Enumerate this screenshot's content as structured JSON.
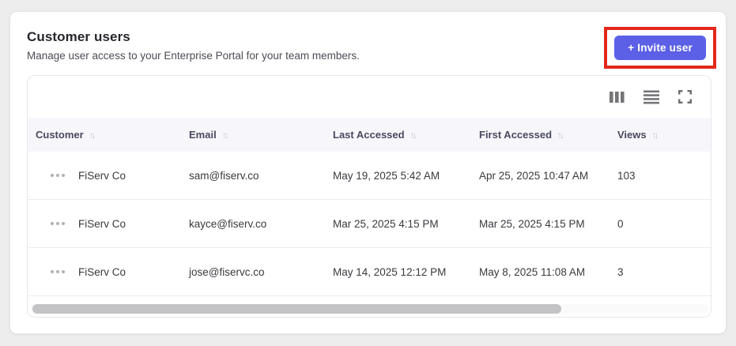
{
  "page": {
    "title": "Customer users",
    "subtitle": "Manage user access to your Enterprise Portal for your team members."
  },
  "invite_button": {
    "label": "+ Invite user",
    "accent_color": "#5b60e6",
    "highlight_border_color": "#e3271b"
  },
  "toolbar": {
    "icons": [
      "column-view-icon",
      "row-density-icon",
      "fullscreen-icon"
    ]
  },
  "table": {
    "sort_up": "↑",
    "sort_down": "↓",
    "header_bg": "#f7f7fb",
    "columns": [
      {
        "label": "Customer"
      },
      {
        "label": "Email"
      },
      {
        "label": "Last Accessed"
      },
      {
        "label": "First Accessed"
      },
      {
        "label": "Views"
      }
    ],
    "rows": [
      {
        "customer": "FiServ Co",
        "email": "sam@fiserv.co",
        "last_accessed": "May 19, 2025 5:42 AM",
        "first_accessed": "Apr 25, 2025 10:47 AM",
        "views": "103"
      },
      {
        "customer": "FiServ Co",
        "email": "kayce@fiserv.co",
        "last_accessed": "Mar 25, 2025 4:15 PM",
        "first_accessed": "Mar 25, 2025 4:15 PM",
        "views": "0"
      },
      {
        "customer": "FiServ Co",
        "email": "jose@fiservc.co",
        "last_accessed": "May 14, 2025 12:12 PM",
        "first_accessed": "May 8, 2025 11:08 AM",
        "views": "3"
      }
    ]
  }
}
